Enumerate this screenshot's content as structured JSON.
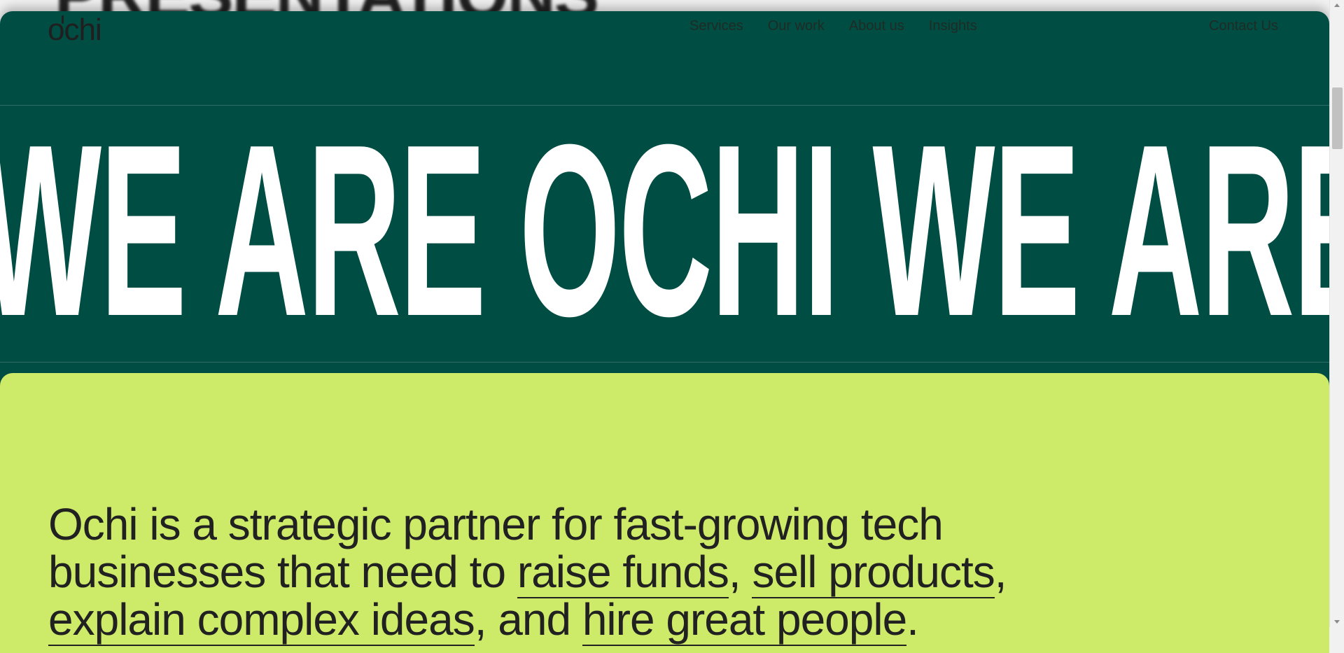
{
  "ghost_heading": "PRESENTATIONS",
  "nav": {
    "logo": "ochi",
    "items": [
      "Services",
      "Our work",
      "About us",
      "Insights"
    ],
    "contact": "Contact Us"
  },
  "marquee": {
    "text": "WE ARE OCHI WE ARE OCHI"
  },
  "about": {
    "line1": "Ochi is a strategic partner for fast-growing tech businesses that need to ",
    "link1": "raise funds",
    "sep1": ", ",
    "link2": "sell products",
    "sep2": ", ",
    "link3": "explain complex ideas",
    "sep3": ", and ",
    "link4": "hire great people",
    "end": "."
  },
  "colors": {
    "dark_green": "#004d43",
    "lime": "#cdea68",
    "text_dark": "#212121"
  }
}
